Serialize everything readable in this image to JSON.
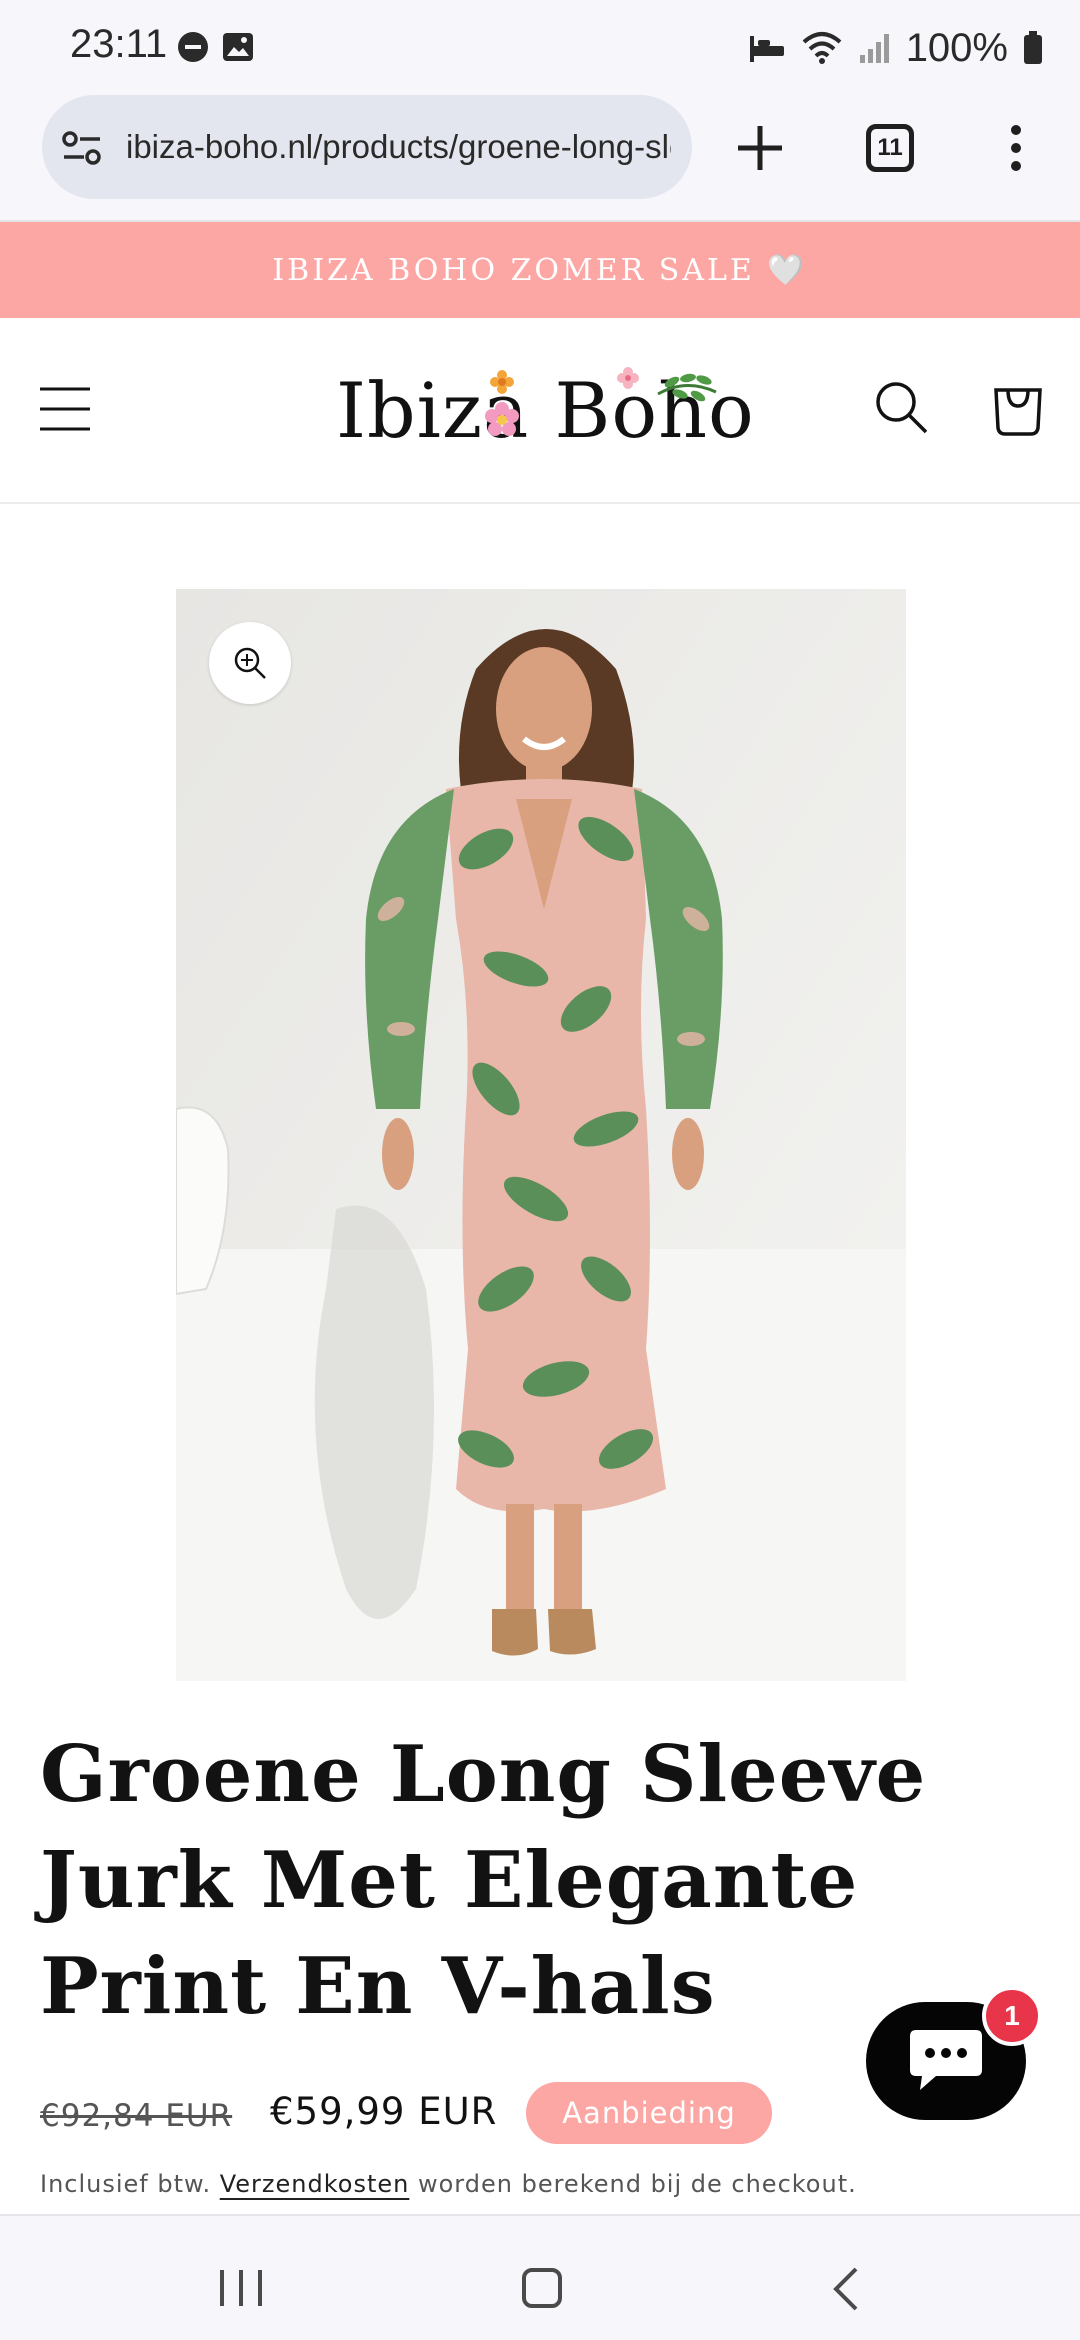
{
  "status_bar": {
    "time": "23:11",
    "battery": "100%",
    "icons": [
      "do-not-disturb-icon",
      "gallery-icon",
      "sleep-mode-icon",
      "wifi-icon",
      "signal-icon",
      "battery-icon"
    ]
  },
  "browser": {
    "url": "ibiza-boho.nl/products/groene-long-sleeve-jurk",
    "tab_count": "11",
    "icons": [
      "site-settings-icon",
      "new-tab-icon",
      "tabs-icon",
      "menu-dots-icon"
    ]
  },
  "announcement": {
    "text": "IBIZA BOHO ZOMER SALE 🤍"
  },
  "header": {
    "logo_text": "Ibiza Boho",
    "icons": [
      "hamburger-icon",
      "search-icon",
      "cart-icon"
    ]
  },
  "product": {
    "title": "Groene Long Sleeve Jurk Met Elegante Print En V-hals",
    "price_old": "€92,84 EUR",
    "price_new": "€59,99 EUR",
    "sale_badge": "Aanbieding",
    "tax_prefix": "Inclusief btw.",
    "tax_link": "Verzendkosten",
    "tax_suffix": "worden berekend bij de checkout."
  },
  "chat": {
    "badge_count": "1"
  },
  "colors": {
    "accent_pink": "#fda7a5",
    "chat_black": "#050505",
    "badge_red": "#e8354a",
    "dress_green": "#5b8f5a",
    "dress_pink": "#e8b7a9"
  }
}
